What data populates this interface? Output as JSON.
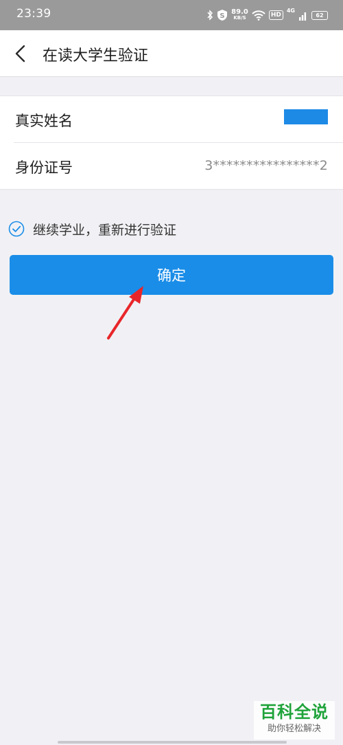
{
  "status_bar": {
    "time": "23:39",
    "speed_value": "89.0",
    "speed_unit": "KB/S",
    "hd": "HD",
    "network": "4G",
    "battery": "62",
    "icons": [
      "bluetooth-icon",
      "shield-icon",
      "wifi-icon",
      "signal-icon",
      "battery-icon"
    ]
  },
  "nav": {
    "title": "在读大学生验证",
    "back_icon": "chevron-left-icon"
  },
  "form": {
    "name_label": "真实姓名",
    "id_label": "身份证号",
    "id_value": "3****************2"
  },
  "consent": {
    "checked": true,
    "text": "继续学业，重新进行验证"
  },
  "confirm_button": {
    "label": "确定"
  },
  "watermark": {
    "title": "百科全说",
    "subtitle": "助你轻松解决"
  },
  "colors": {
    "accent": "#1a8de8",
    "background": "#f1f1f5",
    "annotation_arrow": "#e8262a",
    "watermark": "#1fa33a"
  }
}
